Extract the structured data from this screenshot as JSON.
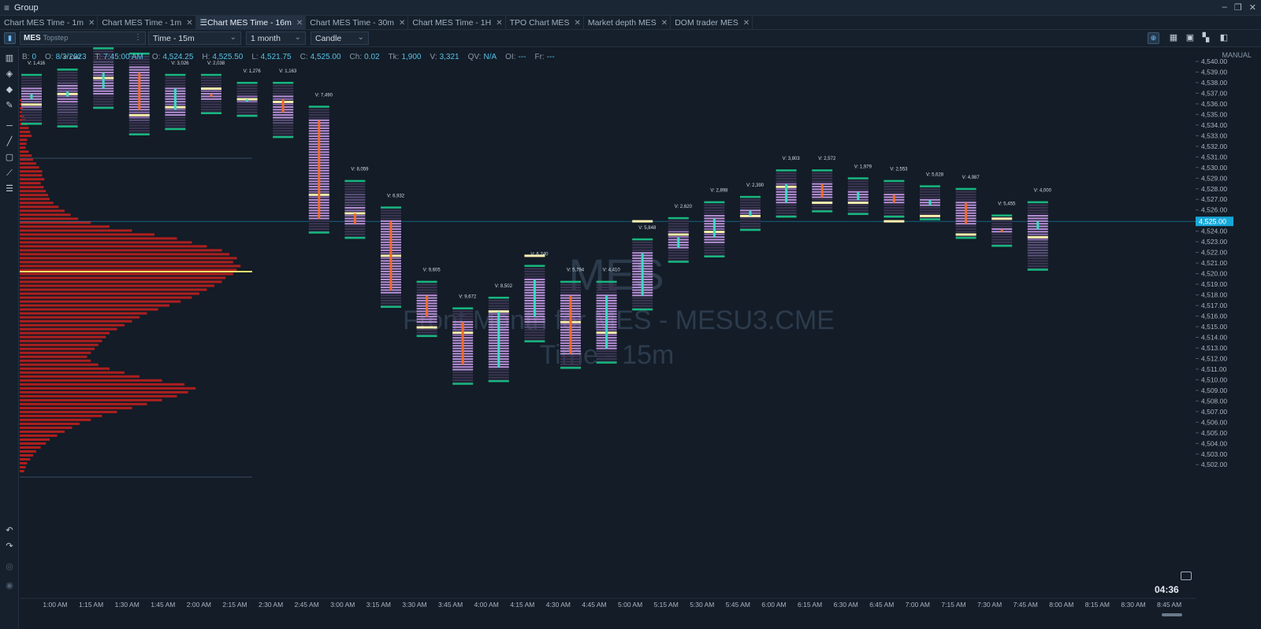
{
  "window": {
    "title": "Group",
    "controls": [
      "–",
      "❐",
      "✕"
    ]
  },
  "tabs": [
    {
      "label": "Chart MES Time - 1m",
      "active": false
    },
    {
      "label": "Chart MES Time - 1m",
      "active": false
    },
    {
      "label": "Chart MES Time - 16m",
      "active": true
    },
    {
      "label": "Chart MES Time - 30m",
      "active": false
    },
    {
      "label": "Chart MES Time - 1H",
      "active": false
    },
    {
      "label": "TPO Chart MES",
      "active": false
    },
    {
      "label": "Market depth MES",
      "active": false
    },
    {
      "label": "DOM trader MES",
      "active": false
    }
  ],
  "toolbar": {
    "symbol": "MES",
    "account": "Topstep",
    "aggregation": "Time - 15m",
    "period": "1 month",
    "chart_type": "Candle"
  },
  "infobar": {
    "items": [
      {
        "k": "B:",
        "v": "0"
      },
      {
        "k": "O:",
        "v": "8/3/2023"
      },
      {
        "k": "T:",
        "v": "7:45:00 AM"
      },
      {
        "k": "O:",
        "v": "4,524.25"
      },
      {
        "k": "H:",
        "v": "4,525.50"
      },
      {
        "k": "L:",
        "v": "4,521.75"
      },
      {
        "k": "C:",
        "v": "4,525.00"
      },
      {
        "k": "Ch:",
        "v": "0.02"
      },
      {
        "k": "Tk:",
        "v": "1,900"
      },
      {
        "k": "V:",
        "v": "3,321"
      },
      {
        "k": "QV:",
        "v": "N/A"
      },
      {
        "k": "OI:",
        "v": "---"
      },
      {
        "k": "Fr:",
        "v": "---"
      }
    ]
  },
  "manual_label": "MANUAL",
  "clock": "04:36",
  "watermark": {
    "line1": "MES",
    "line2": "Front Month for MES - MESU3.CME",
    "line3": "Time - 15m"
  },
  "colors": {
    "up": "#3dd9c4",
    "down": "#f06a2c",
    "poc": "#fff0b0",
    "profile": "#c0201e",
    "last_price": "#16a8d8"
  },
  "chart_data": {
    "type": "footprint_candlestick",
    "current_price": "4,525.00",
    "y_ticks": [
      "4,540.00",
      "4,539.00",
      "4,538.00",
      "4,537.00",
      "4,536.00",
      "4,535.00",
      "4,534.00",
      "4,533.00",
      "4,532.00",
      "4,531.00",
      "4,530.00",
      "4,529.00",
      "4,528.00",
      "4,527.00",
      "4,526.00",
      "4,525.00",
      "4,524.00",
      "4,523.00",
      "4,522.00",
      "4,521.00",
      "4,520.00",
      "4,519.00",
      "4,518.00",
      "4,517.00",
      "4,516.00",
      "4,515.00",
      "4,514.00",
      "4,513.00",
      "4,512.00",
      "4,511.00",
      "4,510.00",
      "4,509.00",
      "4,508.00",
      "4,507.00",
      "4,506.00",
      "4,505.00",
      "4,504.00",
      "4,503.00",
      "4,502.00"
    ],
    "x_ticks": [
      "1:00 AM",
      "1:15 AM",
      "1:30 AM",
      "1:45 AM",
      "2:00 AM",
      "2:15 AM",
      "2:30 AM",
      "2:45 AM",
      "3:00 AM",
      "3:15 AM",
      "3:30 AM",
      "3:45 AM",
      "4:00 AM",
      "4:15 AM",
      "4:30 AM",
      "4:45 AM",
      "5:00 AM",
      "5:15 AM",
      "5:30 AM",
      "5:45 AM",
      "6:00 AM",
      "6:15 AM",
      "6:30 AM",
      "6:45 AM",
      "7:00 AM",
      "7:15 AM",
      "7:30 AM",
      "7:45 AM",
      "8:00 AM",
      "8:15 AM",
      "8:30 AM",
      "8:45 AM"
    ],
    "candles": [
      {
        "time": "12:45 AM",
        "open": 4536.5,
        "high": 4537.5,
        "low": 4535.5,
        "close": 4537.0,
        "volume": "1,416",
        "poc": 4536.0
      },
      {
        "time": "1:00 AM",
        "open": 4536.75,
        "high": 4538.0,
        "low": 4535.25,
        "close": 4537.25,
        "volume": "1,307",
        "poc": 4537.0
      },
      {
        "time": "1:15 AM",
        "open": 4537.5,
        "high": 4540.0,
        "low": 4537.0,
        "close": 4539.0,
        "volume": "",
        "poc": 4538.5
      },
      {
        "time": "1:30 AM",
        "open": 4539.0,
        "high": 4539.5,
        "low": 4534.5,
        "close": 4535.5,
        "volume": "",
        "poc": 4535.0
      },
      {
        "time": "1:45 AM",
        "open": 4535.5,
        "high": 4537.5,
        "low": 4535.0,
        "close": 4537.5,
        "volume": "3,026",
        "poc": 4535.75
      },
      {
        "time": "2:00 AM",
        "open": 4537.0,
        "high": 4537.5,
        "low": 4536.5,
        "close": 4536.75,
        "volume": "2,038",
        "poc": 4537.5
      },
      {
        "time": "2:15 AM",
        "open": 4536.5,
        "high": 4536.75,
        "low": 4536.25,
        "close": 4536.5,
        "volume": "1,276",
        "poc": 4536.5
      },
      {
        "time": "2:30 AM",
        "open": 4536.5,
        "high": 4536.75,
        "low": 4534.25,
        "close": 4535.25,
        "volume": "1,163",
        "poc": 4536.25
      },
      {
        "time": "2:45 AM",
        "open": 4534.5,
        "high": 4534.5,
        "low": 4525.25,
        "close": 4525.25,
        "volume": "7,490",
        "poc": 4527.5
      },
      {
        "time": "3:00 AM",
        "open": 4525.75,
        "high": 4527.5,
        "low": 4524.75,
        "close": 4524.75,
        "volume": "8,059",
        "poc": 4525.75
      },
      {
        "time": "3:15 AM",
        "open": 4525.0,
        "high": 4525.0,
        "low": 4518.25,
        "close": 4518.5,
        "volume": "6,932",
        "poc": 4521.75
      },
      {
        "time": "3:30 AM",
        "open": 4518.0,
        "high": 4518.0,
        "low": 4515.5,
        "close": 4516.0,
        "volume": "9,605",
        "poc": 4515.0
      },
      {
        "time": "3:45 AM",
        "open": 4515.5,
        "high": 4515.5,
        "low": 4511.0,
        "close": 4511.5,
        "volume": "9,672",
        "poc": 4514.5
      },
      {
        "time": "4:00 AM",
        "open": 4511.25,
        "high": 4516.5,
        "low": 4511.25,
        "close": 4516.5,
        "volume": "8,502",
        "poc": 4516.5
      },
      {
        "time": "4:15 AM",
        "open": 4516.0,
        "high": 4519.5,
        "low": 4515.0,
        "close": 4519.5,
        "volume": "6,240",
        "poc": 4521.75
      },
      {
        "time": "4:30 AM",
        "open": 4518.0,
        "high": 4518.0,
        "low": 4512.5,
        "close": 4512.5,
        "volume": "5,794",
        "poc": 4515.5
      },
      {
        "time": "4:45 AM",
        "open": 4513.0,
        "high": 4518.0,
        "low": 4513.0,
        "close": 4518.0,
        "volume": "4,410",
        "poc": 4514.5
      },
      {
        "time": "5:00 AM",
        "open": 4518.0,
        "high": 4522.0,
        "low": 4518.0,
        "close": 4522.0,
        "volume": "5,848",
        "poc": 4525.0
      },
      {
        "time": "5:15 AM",
        "open": 4522.5,
        "high": 4524.0,
        "low": 4522.5,
        "close": 4523.5,
        "volume": "2,620",
        "poc": 4523.75
      },
      {
        "time": "5:30 AM",
        "open": 4523.5,
        "high": 4525.5,
        "low": 4523.0,
        "close": 4525.25,
        "volume": "2,898",
        "poc": 4524.0
      },
      {
        "time": "5:45 AM",
        "open": 4525.5,
        "high": 4526.0,
        "low": 4525.5,
        "close": 4526.0,
        "volume": "2,390",
        "poc": 4525.5
      },
      {
        "time": "6:00 AM",
        "open": 4526.75,
        "high": 4528.5,
        "low": 4526.75,
        "close": 4528.5,
        "volume": "3,803",
        "poc": 4528.25
      },
      {
        "time": "6:15 AM",
        "open": 4528.5,
        "high": 4528.5,
        "low": 4527.25,
        "close": 4527.25,
        "volume": "2,572",
        "poc": 4526.75
      },
      {
        "time": "6:30 AM",
        "open": 4527.0,
        "high": 4527.75,
        "low": 4527.0,
        "close": 4527.75,
        "volume": "1,979",
        "poc": 4526.75
      },
      {
        "time": "6:45 AM",
        "open": 4527.5,
        "high": 4527.5,
        "low": 4526.75,
        "close": 4526.75,
        "volume": "2,553",
        "poc": 4525.0
      },
      {
        "time": "7:00 AM",
        "open": 4526.5,
        "high": 4527.0,
        "low": 4526.5,
        "close": 4527.0,
        "volume": "5,628",
        "poc": 4525.5
      },
      {
        "time": "7:15 AM",
        "open": 4526.75,
        "high": 4526.75,
        "low": 4524.75,
        "close": 4524.75,
        "volume": "4,987",
        "poc": 4523.75
      },
      {
        "time": "7:30 AM",
        "open": 4524.25,
        "high": 4524.25,
        "low": 4524.0,
        "close": 4524.0,
        "volume": "5,455",
        "poc": 4525.25
      },
      {
        "time": "7:45 AM",
        "open": 4524.25,
        "high": 4525.5,
        "low": 4521.75,
        "close": 4525.0,
        "volume": "4,000",
        "poc": 4523.5
      }
    ]
  }
}
